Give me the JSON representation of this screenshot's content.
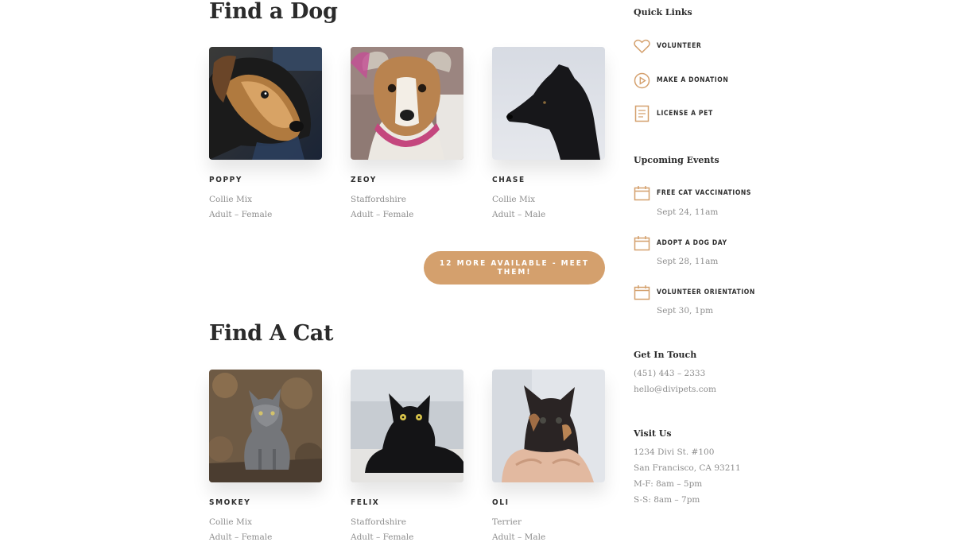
{
  "dogs": {
    "title": "Find a Dog",
    "pets": [
      {
        "name": "POPPY",
        "breed": "Collie Mix",
        "info": "Adult – Female",
        "photo": "dog-photo-poppy"
      },
      {
        "name": "ZEOY",
        "breed": "Staffordshire",
        "info": "Adult – Female",
        "photo": "dog-photo-zeoy"
      },
      {
        "name": "CHASE",
        "breed": "Collie Mix",
        "info": "Adult – Male",
        "photo": "dog-photo-chase"
      }
    ],
    "button_label": "12 MORE AVAILABLE - MEET THEM!"
  },
  "cats": {
    "title": "Find A Cat",
    "pets": [
      {
        "name": "SMOKEY",
        "breed": "Collie Mix",
        "info": "Adult – Female",
        "photo": "cat-photo-smokey"
      },
      {
        "name": "FELIX",
        "breed": "Staffordshire",
        "info": "Adult – Female",
        "photo": "cat-photo-felix"
      },
      {
        "name": "OLI",
        "breed": "Terrier",
        "info": "Adult – Male",
        "photo": "cat-photo-oli"
      }
    ]
  },
  "sidebar": {
    "quick_links": {
      "title": "Quick Links",
      "items": [
        {
          "label": "VOLUNTEER",
          "icon": "heart-icon"
        },
        {
          "label": "MAKE A DONATION",
          "icon": "play-circle-icon"
        },
        {
          "label": "LICENSE A PET",
          "icon": "document-icon"
        }
      ]
    },
    "events": {
      "title": "Upcoming Events",
      "items": [
        {
          "label": "FREE CAT VACCINATIONS",
          "date": "Sept 24, 11am",
          "icon": "calendar-icon"
        },
        {
          "label": "ADOPT A DOG DAY",
          "date": "Sept 28, 11am",
          "icon": "calendar-icon"
        },
        {
          "label": "VOLUNTEER ORIENTATION",
          "date": "Sept 30, 1pm",
          "icon": "calendar-icon"
        }
      ]
    },
    "contact": {
      "title": "Get In Touch",
      "phone": "(451) 443 – 2333",
      "email": "hello@divipets.com"
    },
    "visit": {
      "title": "Visit Us",
      "address1": "1234 Divi St. #100",
      "address2": "San Francisco, CA 93211",
      "hours1": "M-F: 8am – 5pm",
      "hours2": "S-S: 8am – 7pm"
    }
  },
  "colors": {
    "accent": "#d4a06d",
    "heading": "#2b2b2b",
    "muted": "#8d8d8d"
  }
}
